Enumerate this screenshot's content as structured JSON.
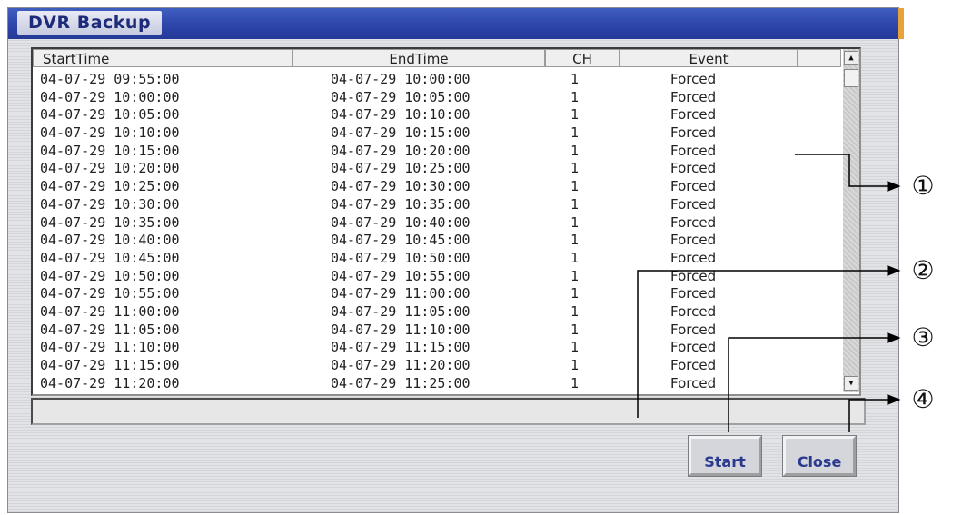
{
  "window": {
    "title": "DVR Backup"
  },
  "listview": {
    "columns": [
      "StartTime",
      "EndTime",
      "CH",
      "Event"
    ],
    "rows": [
      {
        "start": "04-07-29 09:55:00",
        "end": "04-07-29 10:00:00",
        "ch": "1",
        "event": "Forced"
      },
      {
        "start": "04-07-29 10:00:00",
        "end": "04-07-29 10:05:00",
        "ch": "1",
        "event": "Forced"
      },
      {
        "start": "04-07-29 10:05:00",
        "end": "04-07-29 10:10:00",
        "ch": "1",
        "event": "Forced"
      },
      {
        "start": "04-07-29 10:10:00",
        "end": "04-07-29 10:15:00",
        "ch": "1",
        "event": "Forced"
      },
      {
        "start": "04-07-29 10:15:00",
        "end": "04-07-29 10:20:00",
        "ch": "1",
        "event": "Forced"
      },
      {
        "start": "04-07-29 10:20:00",
        "end": "04-07-29 10:25:00",
        "ch": "1",
        "event": "Forced"
      },
      {
        "start": "04-07-29 10:25:00",
        "end": "04-07-29 10:30:00",
        "ch": "1",
        "event": "Forced"
      },
      {
        "start": "04-07-29 10:30:00",
        "end": "04-07-29 10:35:00",
        "ch": "1",
        "event": "Forced"
      },
      {
        "start": "04-07-29 10:35:00",
        "end": "04-07-29 10:40:00",
        "ch": "1",
        "event": "Forced"
      },
      {
        "start": "04-07-29 10:40:00",
        "end": "04-07-29 10:45:00",
        "ch": "1",
        "event": "Forced"
      },
      {
        "start": "04-07-29 10:45:00",
        "end": "04-07-29 10:50:00",
        "ch": "1",
        "event": "Forced"
      },
      {
        "start": "04-07-29 10:50:00",
        "end": "04-07-29 10:55:00",
        "ch": "1",
        "event": "Forced"
      },
      {
        "start": "04-07-29 10:55:00",
        "end": "04-07-29 11:00:00",
        "ch": "1",
        "event": "Forced"
      },
      {
        "start": "04-07-29 11:00:00",
        "end": "04-07-29 11:05:00",
        "ch": "1",
        "event": "Forced"
      },
      {
        "start": "04-07-29 11:05:00",
        "end": "04-07-29 11:10:00",
        "ch": "1",
        "event": "Forced"
      },
      {
        "start": "04-07-29 11:10:00",
        "end": "04-07-29 11:15:00",
        "ch": "1",
        "event": "Forced"
      },
      {
        "start": "04-07-29 11:15:00",
        "end": "04-07-29 11:20:00",
        "ch": "1",
        "event": "Forced"
      },
      {
        "start": "04-07-29 11:20:00",
        "end": "04-07-29 11:25:00",
        "ch": "1",
        "event": "Forced"
      }
    ]
  },
  "buttons": {
    "start_label": "Start",
    "close_label": "Close"
  },
  "callouts": [
    "①",
    "②",
    "③",
    "④"
  ],
  "icons": {
    "scroll_up": "scroll-up-arrow-icon",
    "scroll_down": "scroll-down-arrow-icon"
  },
  "colors": {
    "title_bar": "#2c43a8",
    "title_text": "#1e2a7a",
    "button_text": "#2a3a8e"
  }
}
